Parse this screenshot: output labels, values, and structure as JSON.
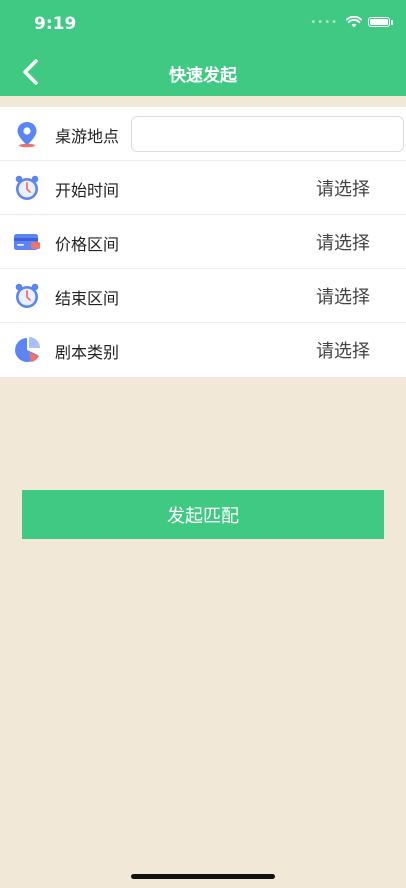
{
  "status_bar": {
    "time": "9:19",
    "signal_icon": "signal-dots-icon",
    "wifi_icon": "wifi-icon",
    "battery_icon": "battery-icon"
  },
  "nav": {
    "back_icon": "chevron-left-icon",
    "title": "快速发起"
  },
  "form": {
    "rows": [
      {
        "label": "桌游地点",
        "icon": "location-pin-icon",
        "input_value": "",
        "input_placeholder": ""
      },
      {
        "label": "开始时间",
        "icon": "alarm-clock-icon",
        "value": "请选择"
      },
      {
        "label": "价格区间",
        "icon": "credit-card-icon",
        "value": "请选择"
      },
      {
        "label": "结束区间",
        "icon": "alarm-clock-icon",
        "value": "请选择"
      },
      {
        "label": "剧本类别",
        "icon": "pie-chart-icon",
        "value": "请选择"
      }
    ]
  },
  "actions": {
    "match_label": "发起匹配"
  },
  "colors": {
    "brand_green": "#3fc983",
    "background": "#f1e8d8",
    "icon_blue": "#5b84f4",
    "icon_red": "#f0726e"
  }
}
